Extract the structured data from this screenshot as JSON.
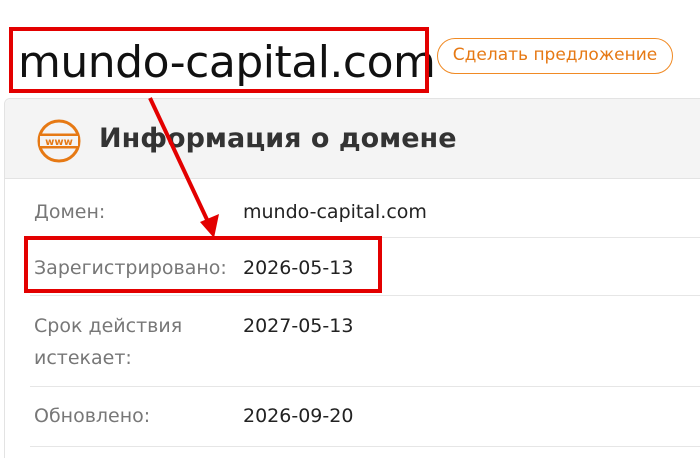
{
  "header": {
    "domain": "mundo-capital.com",
    "offer_button": "Сделать предложение"
  },
  "card": {
    "title": "Информация о домене",
    "icon": "www-icon",
    "rows": [
      {
        "label": "Домен:",
        "value": "mundo-capital.com"
      },
      {
        "label": "Зарегистрировано:",
        "value": "2026-05-13"
      },
      {
        "label": "Срок действия",
        "label2": "истекает:",
        "value": "2027-05-13"
      },
      {
        "label": "Обновлено:",
        "value": "2026-09-20"
      }
    ]
  },
  "colors": {
    "accent_orange": "#f08a24",
    "annotation_red": "#e30000"
  }
}
